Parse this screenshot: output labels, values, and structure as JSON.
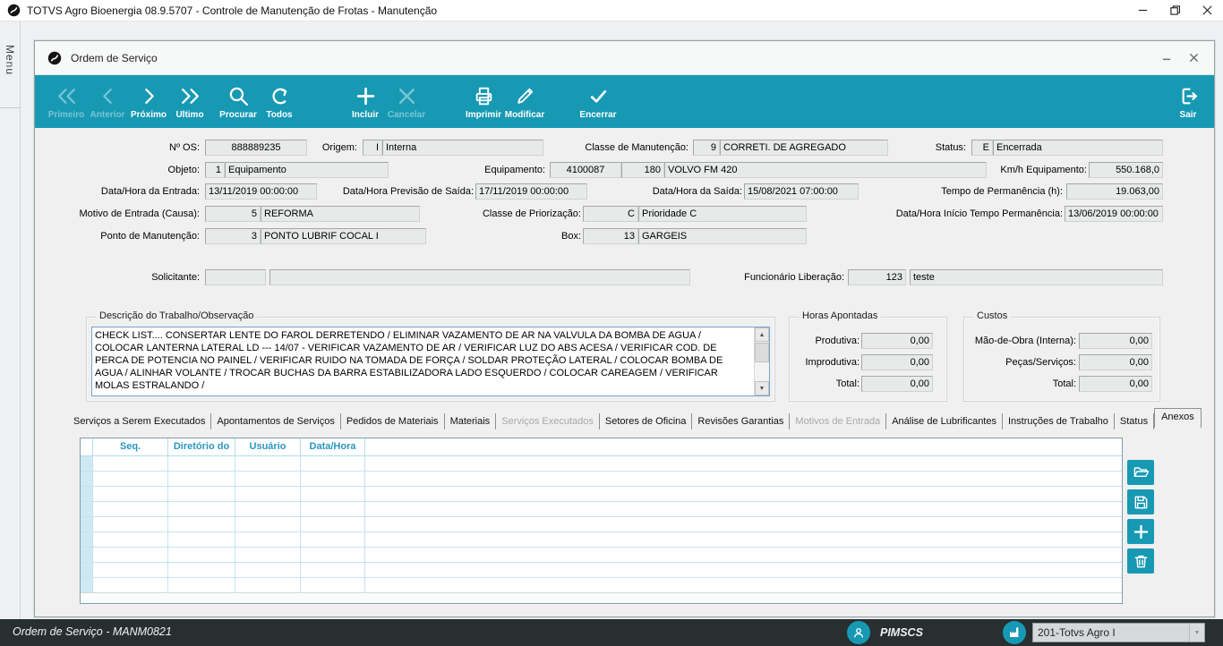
{
  "colors": {
    "accent": "#1799b4",
    "statusbar_bg": "#272f31",
    "grid_header_text": "#2a97c0",
    "grid_line": "#b5dcea",
    "row_selector_bg": "#cfe9f4"
  },
  "window": {
    "title": "TOTVS Agro Bioenergia 08.9.5707 - Controle de Manutenção de Frotas - Manutenção"
  },
  "menu": {
    "label": "Menu"
  },
  "dialog": {
    "title": "Ordem de Serviço"
  },
  "toolbar": {
    "buttons": [
      {
        "label": "Primeiro",
        "enabled": false
      },
      {
        "label": "Anterior",
        "enabled": false
      },
      {
        "label": "Próximo",
        "enabled": true
      },
      {
        "label": "Ultimo",
        "enabled": true
      },
      {
        "label": "Procurar",
        "enabled": true
      },
      {
        "label": "Todos",
        "enabled": true
      },
      {
        "label": "Incluir",
        "enabled": true
      },
      {
        "label": "Cancelar",
        "enabled": false
      },
      {
        "label": "Imprimir",
        "enabled": true
      },
      {
        "label": "Modificar",
        "enabled": true
      },
      {
        "label": "Encerrar",
        "enabled": true
      },
      {
        "label": "Sair",
        "enabled": true
      }
    ]
  },
  "fields": {
    "os": {
      "label": "Nº OS:",
      "value": "888889235"
    },
    "origem": {
      "label": "Origem:",
      "code": "I",
      "desc": "Interna"
    },
    "classe_manutencao": {
      "label": "Classe de Manutenção:",
      "code": "9",
      "desc": "CORRETI. DE AGREGADO"
    },
    "status": {
      "label": "Status:",
      "code": "E",
      "desc": "Encerrada"
    },
    "objeto": {
      "label": "Objeto:",
      "code": "1",
      "desc": "Equipamento"
    },
    "equipamento": {
      "label": "Equipamento:",
      "code": "4100087",
      "code2": "180",
      "desc": "VOLVO FM 420"
    },
    "kmh": {
      "label": "Km/h Equipamento:",
      "value": "550.168,0"
    },
    "entrada": {
      "label": "Data/Hora da Entrada:",
      "value": "13/11/2019 00:00:00"
    },
    "previsao_saida": {
      "label": "Data/Hora Previsão de Saída:",
      "value": "17/11/2019 00:00:00"
    },
    "saida": {
      "label": "Data/Hora da Saída:",
      "value": "15/08/2021 07:00:00"
    },
    "tempo_permanencia": {
      "label": "Tempo de Permanência (h):",
      "value": "19.063,00"
    },
    "motivo_entrada": {
      "label": "Motivo de Entrada (Causa):",
      "code": "5",
      "desc": "REFORMA"
    },
    "classe_priorizacao": {
      "label": "Classe de Priorização:",
      "code": "C",
      "desc": "Prioridade C"
    },
    "inicio_permanencia": {
      "label": "Data/Hora Início Tempo Permanência:",
      "value": "13/06/2019 00:00:00"
    },
    "ponto_manutencao": {
      "label": "Ponto de Manutenção:",
      "code": "3",
      "desc": "PONTO LUBRIF COCAL I"
    },
    "box": {
      "label": "Box:",
      "code": "13",
      "desc": "GARGEIS"
    },
    "solicitante": {
      "label": "Solicitante:",
      "code": "",
      "desc": ""
    },
    "funcionario_liberacao": {
      "label": "Funcionário Liberação:",
      "code": "123",
      "desc": "teste"
    }
  },
  "descricao": {
    "group_title": "Descrição do Trabalho/Observação",
    "text": "CHECK LIST.... CONSERTAR LENTE DO FAROL DERRETENDO / ELIMINAR VAZAMENTO DE AR NA VALVULA DA BOMBA DE AGUA / COLOCAR LANTERNA LATERAL LD --- 14/07 - VERIFICAR VAZAMENTO DE AR / VERIFICAR LUZ DO ABS ACESA / VERIFICAR COD. DE PERCA DE POTENCIA NO PAINEL / VERIFICAR RUIDO NA TOMADA DE FORÇA / SOLDAR PROTEÇÃO LATERAL / COLOCAR BOMBA DE AGUA / ALINHAR VOLANTE / TROCAR BUCHAS DA BARRA ESTABILIZADORA LADO ESQUERDO / COLOCAR CAREAGEM / VERIFICAR MOLAS ESTRALANDO /"
  },
  "horas": {
    "group_title": "Horas Apontadas",
    "rows": [
      {
        "label": "Produtiva:",
        "value": "0,00"
      },
      {
        "label": "Improdutiva:",
        "value": "0,00"
      },
      {
        "label": "Total:",
        "value": "0,00"
      }
    ]
  },
  "custos": {
    "group_title": "Custos",
    "rows": [
      {
        "label": "Mão-de-Obra (Interna):",
        "value": "0,00"
      },
      {
        "label": "Peças/Serviços:",
        "value": "0,00"
      },
      {
        "label": "Total:",
        "value": "0,00"
      }
    ]
  },
  "tabs": [
    {
      "label": "Serviços a Serem Executados",
      "state": "normal"
    },
    {
      "label": "Apontamentos de Serviços",
      "state": "normal"
    },
    {
      "label": "Pedidos de Materiais",
      "state": "normal"
    },
    {
      "label": "Materiais",
      "state": "normal"
    },
    {
      "label": "Serviços Executados",
      "state": "disabled"
    },
    {
      "label": "Setores de Oficina",
      "state": "normal"
    },
    {
      "label": "Revisões Garantias",
      "state": "normal"
    },
    {
      "label": "Motivos de Entrada",
      "state": "disabled"
    },
    {
      "label": "Análise de Lubrificantes",
      "state": "normal"
    },
    {
      "label": "Instruções de Trabalho",
      "state": "normal"
    },
    {
      "label": "Status",
      "state": "normal"
    },
    {
      "label": "Anexos",
      "state": "active"
    }
  ],
  "grid": {
    "columns": [
      "",
      "Seq.",
      "Diretório do",
      "Usuário",
      "Data/Hora",
      ""
    ],
    "row_count": 9
  },
  "statusbar": {
    "program": "Ordem de Serviço - MANM0821",
    "user": "PIMSCS",
    "company": "201-Totvs Agro I"
  }
}
